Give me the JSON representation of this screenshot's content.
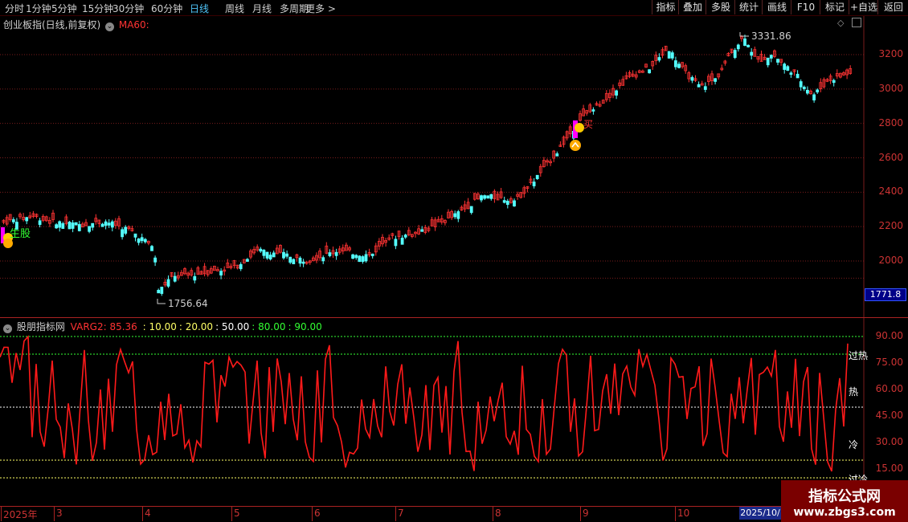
{
  "toolbar": {
    "periods": [
      "分时",
      "1分钟",
      "5分钟",
      "15分钟",
      "30分钟",
      "60分钟",
      "日线",
      "周线",
      "月线",
      "多周期",
      "更多 >"
    ],
    "active_period": "日线",
    "right_buttons": [
      "指标",
      "叠加",
      "多股",
      "统计",
      "画线",
      "F10",
      "标记",
      "+自选",
      "返回"
    ]
  },
  "main_chart": {
    "title": "创业板指(日线,前复权)",
    "ma_label": "MA60:",
    "y_ticks": [
      "3200",
      "3000",
      "2800",
      "2600",
      "2400",
      "2200",
      "2000"
    ],
    "current_price": "1771.8",
    "high_label": "3331.86",
    "low_label": "1756.64",
    "signal_buy": "买",
    "signal_strong_buy": "生股",
    "colors": {
      "up": "#ff3333",
      "down": "#54ffff",
      "background": "#000000",
      "grid": "#7a1c1c",
      "accent": "#ff00ff"
    }
  },
  "indicator": {
    "name": "股朋指标网",
    "varg_label": "VARG2: 85.36",
    "levels": [
      {
        "label": "10.00",
        "color": "#ffff66"
      },
      {
        "label": "20.00",
        "color": "#ffff66"
      },
      {
        "label": "50.00",
        "color": "#ffffff"
      },
      {
        "label": "80.00",
        "color": "#33ff33"
      },
      {
        "label": "90.00",
        "color": "#33ff33"
      }
    ],
    "y_ticks": [
      "90.00",
      "75.00",
      "60.00",
      "45.00",
      "30.00",
      "15.00"
    ],
    "zones": [
      "过热",
      "热",
      "冷",
      "过冷"
    ]
  },
  "time_axis": {
    "months": [
      "2025年",
      "3",
      "4",
      "5",
      "6",
      "7",
      "8",
      "9",
      "10"
    ],
    "current_date": "2025/10/"
  },
  "watermark": {
    "title": "指标公式网",
    "url": "www.zbgs3.com"
  }
}
